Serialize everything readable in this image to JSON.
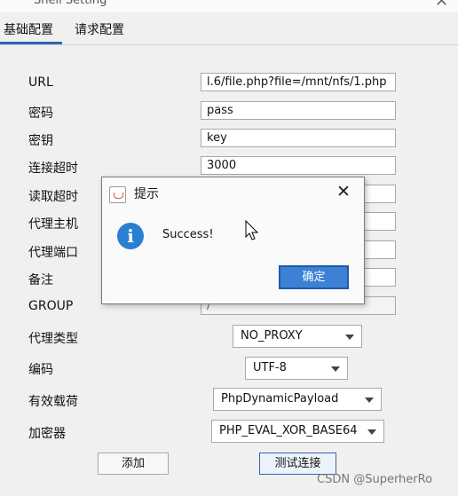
{
  "window": {
    "title": "Shell Setting",
    "close_glyph": "✕"
  },
  "tabs": [
    {
      "label": "基础配置",
      "active": true
    },
    {
      "label": "请求配置",
      "active": false
    }
  ],
  "form": {
    "url_label": "URL",
    "url_value": "l.6/file.php?file=/mnt/nfs/1.php",
    "password_label": "密码",
    "password_value": "pass",
    "secret_key_label": "密钥",
    "secret_key_value": "key",
    "connect_timeout_label": "连接超时",
    "connect_timeout_value": "3000",
    "read_timeout_label": "读取超时",
    "proxy_host_label": "代理主机",
    "proxy_port_label": "代理端口",
    "remark_label": "备注",
    "group_label": "GROUP",
    "group_value": "/",
    "proxy_type_label": "代理类型",
    "proxy_type_value": "NO_PROXY",
    "encoding_label": "编码",
    "encoding_value": "UTF-8",
    "payload_label": "有效载荷",
    "payload_value": "PhpDynamicPayload",
    "cryption_label": "加密器",
    "cryption_value": "PHP_EVAL_XOR_BASE64"
  },
  "buttons": {
    "add": "添加",
    "test_connection": "测试连接"
  },
  "dialog": {
    "title": "提示",
    "close_glyph": "✕",
    "info_glyph": "i",
    "message": "Success!",
    "ok_label": "确定"
  },
  "watermark": "CSDN @SuperherRo",
  "colors": {
    "accent": "#2f65b5",
    "ok_button": "#3c81d6",
    "info_icon": "#2b7fd0"
  }
}
